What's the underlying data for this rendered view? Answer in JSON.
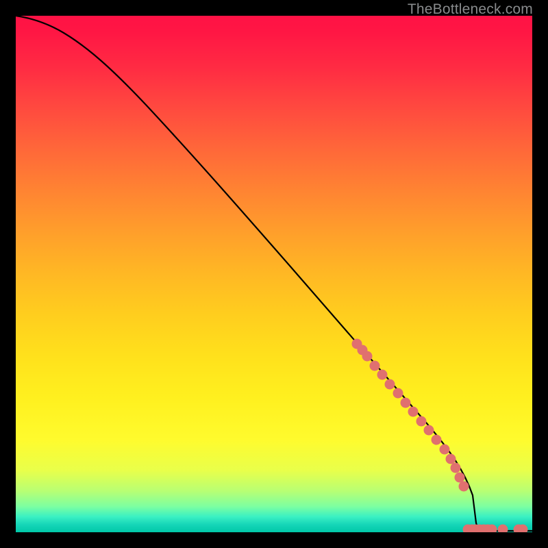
{
  "watermark": "TheBottleneck.com",
  "chart_data": {
    "type": "line",
    "title": "",
    "xlabel": "",
    "ylabel": "",
    "xlim": [
      0,
      100
    ],
    "ylim": [
      0,
      100
    ],
    "background_gradient": {
      "direction": "vertical",
      "stops": [
        {
          "pos": 0.0,
          "color": "#ff1245"
        },
        {
          "pos": 0.5,
          "color": "#ffb824"
        },
        {
          "pos": 0.82,
          "color": "#fffb2d"
        },
        {
          "pos": 1.0,
          "color": "#00c8a8"
        }
      ]
    },
    "series": [
      {
        "name": "threshold-curve",
        "color": "#000000",
        "x": [
          0,
          2,
          5,
          8,
          12,
          18,
          25,
          35,
          45,
          55,
          65,
          75,
          82,
          86,
          88,
          92,
          96,
          100
        ],
        "y": [
          100,
          99.6,
          99.0,
          97.8,
          95.5,
          91.0,
          83.8,
          72.4,
          60.8,
          49.2,
          37.6,
          26.0,
          17.5,
          11.5,
          7.0,
          2.5,
          0.4,
          0.3
        ]
      },
      {
        "name": "highlight-dots-diagonal",
        "color": "#e36f6f",
        "type": "scatter",
        "x": [
          66,
          67,
          68,
          69.5,
          71,
          72.5,
          74,
          75.5,
          77,
          78.5,
          80,
          81.5,
          83,
          84.2,
          85.2,
          86,
          86.8
        ],
        "y": [
          36.4,
          35.2,
          34.0,
          32.2,
          30.4,
          28.6,
          26.8,
          25.0,
          23.2,
          21.4,
          19.6,
          17.8,
          16.0,
          14.2,
          12.4,
          10.6,
          8.8
        ]
      },
      {
        "name": "highlight-dots-bottom",
        "color": "#e36f6f",
        "type": "scatter",
        "x": [
          87.5,
          88.3,
          89.0,
          89.8,
          90.6,
          91.4,
          92.2,
          94.3,
          97.3,
          98.2
        ],
        "y": [
          0.5,
          0.5,
          0.5,
          0.5,
          0.5,
          0.5,
          0.5,
          0.5,
          0.5,
          0.5
        ]
      }
    ]
  }
}
